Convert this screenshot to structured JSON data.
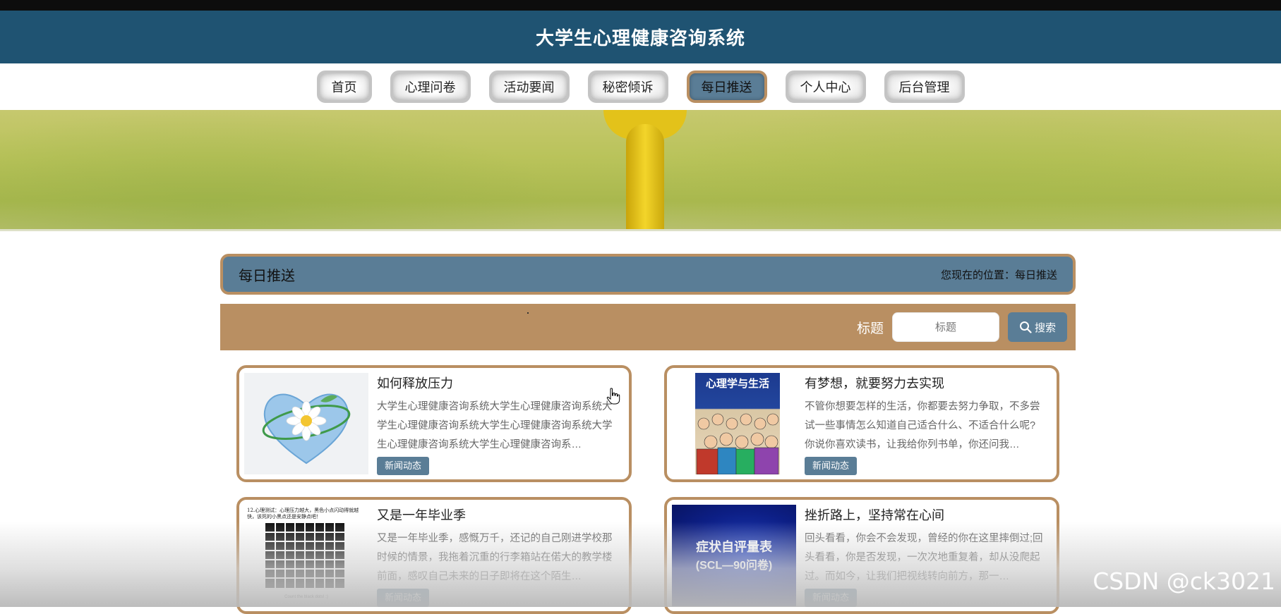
{
  "site": {
    "title": "大学生心理健康咨询系统"
  },
  "nav": {
    "items": [
      {
        "label": "首页"
      },
      {
        "label": "心理问卷"
      },
      {
        "label": "活动要闻"
      },
      {
        "label": "秘密倾诉"
      },
      {
        "label": "每日推送",
        "active": true
      },
      {
        "label": "个人中心"
      },
      {
        "label": "后台管理"
      }
    ]
  },
  "section": {
    "title": "每日推送",
    "breadcrumb": "您现在的位置：每日推送"
  },
  "search": {
    "label": "标题",
    "placeholder": "标题",
    "button_label": "搜索"
  },
  "cards": [
    {
      "title": "如何释放压力",
      "summary": "大学生心理健康咨询系统大学生心理健康咨询系统大学生心理健康咨询系统大学生心理健康咨询系统大学生心理健康咨询系统大学生心理健康咨询系…",
      "tag": "新闻动态",
      "thumb_icon": "heart-flower-icon"
    },
    {
      "title": "有梦想，就要努力去实现",
      "summary": "不管你想要怎样的生活，你都要去努力争取，不多尝试一些事情怎么知道自己适合什么、不适合什么呢?你说你喜欢读书，让我给你列书单，你还问我…",
      "tag": "新闻动态",
      "thumb_text": "心理学与生活",
      "thumb_icon": "book-cover-icon"
    },
    {
      "title": "又是一年毕业季",
      "summary": "又是一年毕业季，感慨万千，还记的自己刚进学校那时候的情景，我拖着沉重的行李箱站在偌大的教学楼前面，感叹自己未来的日子即将在这个陌生…",
      "tag": "新闻动态",
      "thumb_text": "12.心理测试：心理压力越大，黑色小点闪动得就越快，该死的小黑点还是安静点吧！",
      "thumb_caption": "Count the black dots! :)",
      "thumb_icon": "grid-illusion-icon"
    },
    {
      "title": "挫折路上，坚持常在心间",
      "summary": "回头看看，你会不会发现，曾经的你在这里摔倒过;回头看看，你是否发现，一次次地重复着，却从没爬起过。而如今，让我们把视线转向前方，那一…",
      "tag": "新闻动态",
      "thumb_text": "症状自评量表",
      "thumb_text2": "(SCL—90问卷)",
      "thumb_icon": "scale-cover-icon"
    }
  ],
  "watermark": "CSDN @ck3021",
  "colors": {
    "header_bg": "#1f5372",
    "accent_blue": "#5a7d96",
    "accent_tan": "#b98f62"
  }
}
